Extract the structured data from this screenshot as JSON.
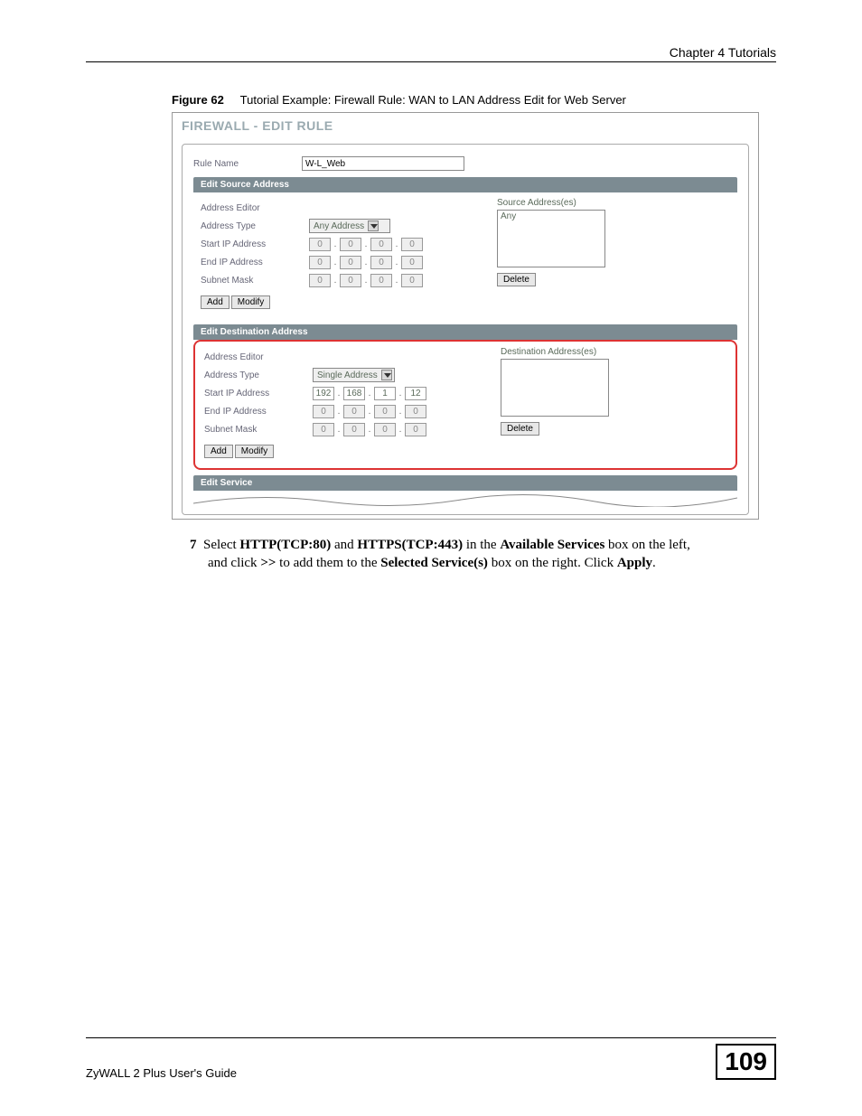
{
  "header": {
    "chapter": "Chapter 4 Tutorials"
  },
  "figure": {
    "label": "Figure 62",
    "caption": "Tutorial Example: Firewall Rule: WAN to LAN Address Edit for Web Server"
  },
  "screenshot": {
    "title": "FIREWALL - EDIT RULE",
    "ruleName": {
      "label": "Rule Name",
      "value": "W-L_Web"
    },
    "source": {
      "header": "Edit Source Address",
      "editorLabel": "Address Editor",
      "addressTypeLabel": "Address Type",
      "addressType": "Any Address",
      "startIpLabel": "Start IP Address",
      "startIp": [
        "0",
        "0",
        "0",
        "0"
      ],
      "endIpLabel": "End IP Address",
      "endIp": [
        "0",
        "0",
        "0",
        "0"
      ],
      "maskLabel": "Subnet Mask",
      "mask": [
        "0",
        "0",
        "0",
        "0"
      ],
      "addBtn": "Add",
      "modifyBtn": "Modify",
      "listLabel": "Source Address(es)",
      "listItems": [
        "Any"
      ],
      "deleteBtn": "Delete"
    },
    "dest": {
      "header": "Edit Destination Address",
      "editorLabel": "Address Editor",
      "addressTypeLabel": "Address Type",
      "addressType": "Single Address",
      "startIpLabel": "Start IP Address",
      "startIp": [
        "192",
        "168",
        "1",
        "12"
      ],
      "endIpLabel": "End IP Address",
      "endIp": [
        "0",
        "0",
        "0",
        "0"
      ],
      "maskLabel": "Subnet Mask",
      "mask": [
        "0",
        "0",
        "0",
        "0"
      ],
      "addBtn": "Add",
      "modifyBtn": "Modify",
      "listLabel": "Destination Address(es)",
      "deleteBtn": "Delete"
    },
    "service": {
      "header": "Edit Service"
    }
  },
  "step": {
    "num": "7",
    "pre": "Select ",
    "http": "HTTP(TCP:80)",
    "and1": " and ",
    "https": "HTTPS(TCP:443)",
    "mid1": " in the ",
    "avail": "Available Services",
    "mid2": " box on the left, and click ",
    "move": ">>",
    "mid3": " to add them to the ",
    "selsvc": "Selected Service(s)",
    "mid4": " box on the right. Click ",
    "apply": "Apply",
    "end": "."
  },
  "footer": {
    "guide": "ZyWALL 2 Plus User's Guide",
    "page": "109"
  }
}
